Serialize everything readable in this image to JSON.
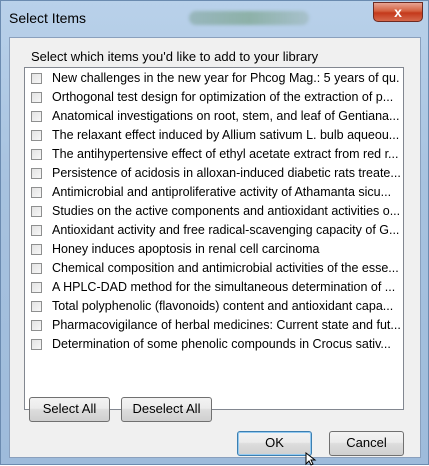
{
  "window": {
    "title": "Select Items",
    "close_glyph": "x"
  },
  "dialog": {
    "prompt": "Select which items you'd like to add to your library",
    "items": [
      {
        "label": "New challenges in the new year for Phcog Mag.: 5 years of qu...",
        "checked": false
      },
      {
        "label": "Orthogonal test design for optimization of the extraction of p...",
        "checked": false
      },
      {
        "label": "Anatomical investigations on root, stem, and leaf of Gentiana...",
        "checked": false
      },
      {
        "label": "The relaxant effect induced by Allium sativum L. bulb aqueou...",
        "checked": false
      },
      {
        "label": "The antihypertensive effect of ethyl acetate extract from red r...",
        "checked": false
      },
      {
        "label": "Persistence of acidosis in alloxan-induced diabetic rats treate...",
        "checked": false
      },
      {
        "label": "Antimicrobial and antiproliferative activity of Athamanta sicu...",
        "checked": false
      },
      {
        "label": "Studies on the active components and antioxidant activities o...",
        "checked": false
      },
      {
        "label": "Antioxidant activity and free radical-scavenging capacity of G...",
        "checked": false
      },
      {
        "label": "Honey induces apoptosis in renal cell carcinoma",
        "checked": false
      },
      {
        "label": "Chemical composition and antimicrobial activities of the esse...",
        "checked": false
      },
      {
        "label": "A HPLC-DAD method for the simultaneous determination of ...",
        "checked": false
      },
      {
        "label": "Total polyphenolic (flavonoids) content and antioxidant capa...",
        "checked": false
      },
      {
        "label": "Pharmacovigilance of herbal medicines: Current state and fut...",
        "checked": false
      },
      {
        "label": "Determination of some phenolic compounds in Crocus sativ...",
        "checked": false
      }
    ],
    "buttons": {
      "select_all": "Select All",
      "deselect_all": "Deselect All",
      "ok": "OK",
      "cancel": "Cancel"
    }
  },
  "colors": {
    "frame": "#b9d1ea",
    "close_button": "#c4391b",
    "default_button_border": "#3c7fb1"
  }
}
